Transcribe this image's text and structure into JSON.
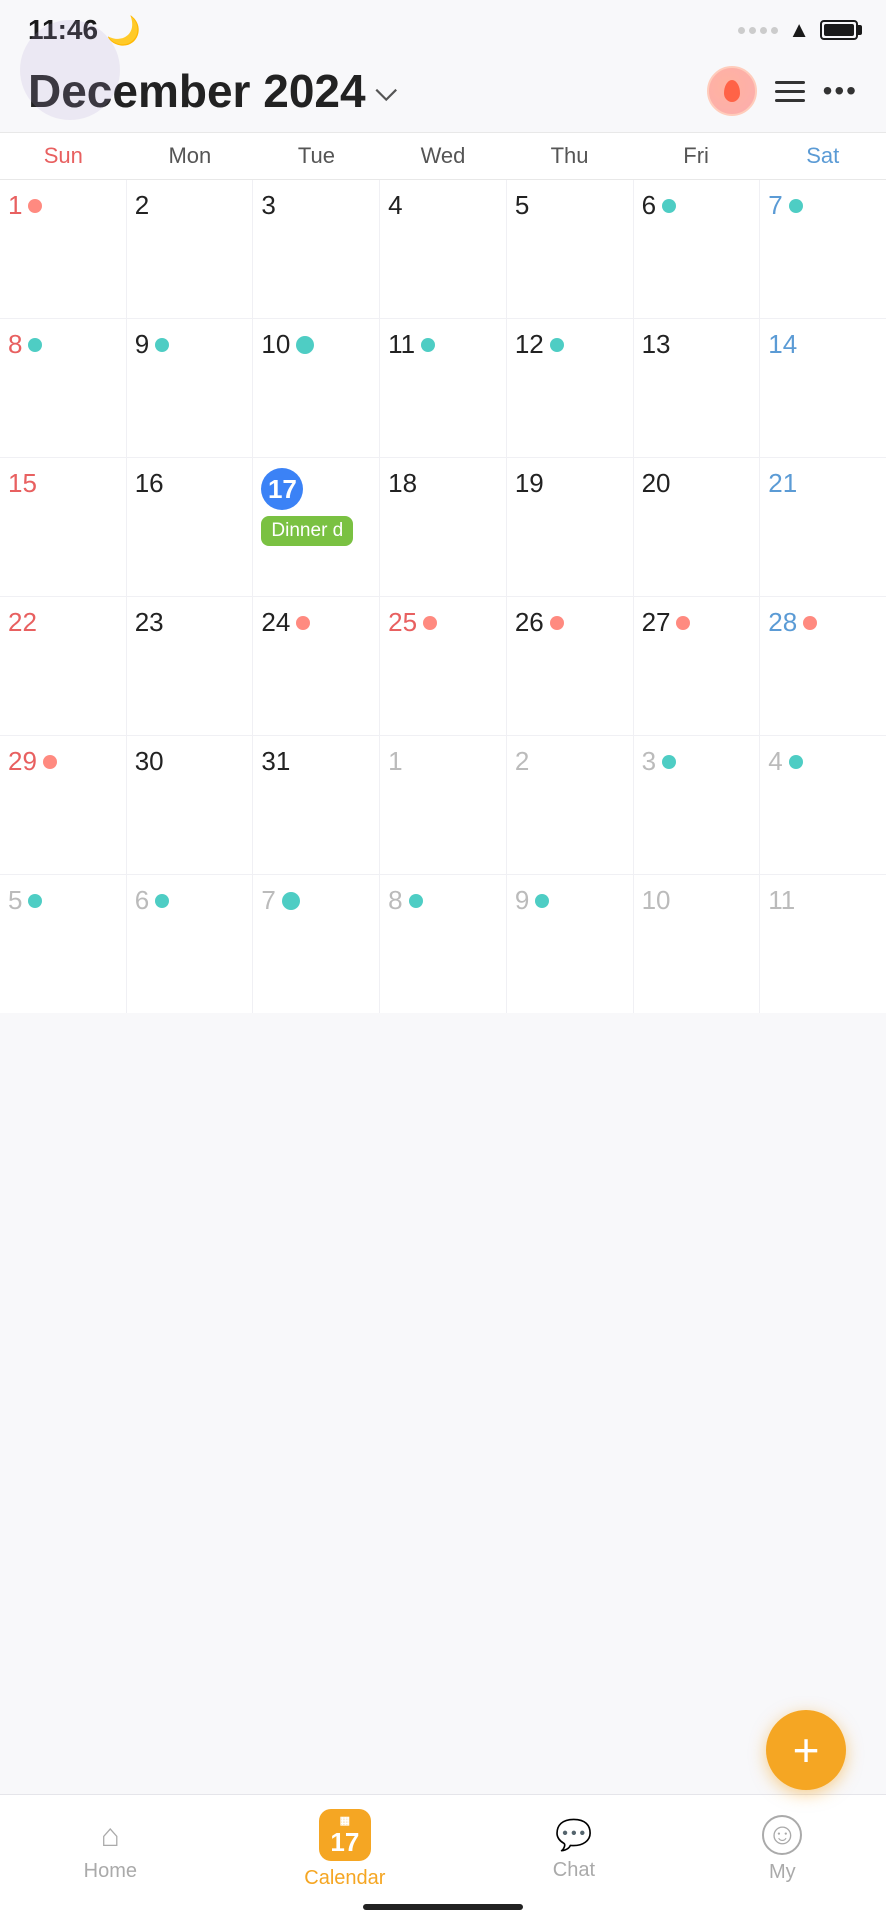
{
  "statusBar": {
    "time": "11:46",
    "moonIcon": "🌙"
  },
  "header": {
    "title": "December 2024",
    "chevron": "∨"
  },
  "daysOfWeek": [
    "Sun",
    "Mon",
    "Tue",
    "Wed",
    "Thu",
    "Fri",
    "Sat"
  ],
  "calendar": {
    "weeks": [
      [
        {
          "day": 1,
          "type": "sun",
          "dot": "red",
          "otherMonth": false
        },
        {
          "day": 2,
          "type": "",
          "dot": "",
          "otherMonth": false
        },
        {
          "day": 3,
          "type": "",
          "dot": "",
          "otherMonth": false
        },
        {
          "day": 4,
          "type": "",
          "dot": "",
          "otherMonth": false
        },
        {
          "day": 5,
          "type": "",
          "dot": "",
          "otherMonth": false
        },
        {
          "day": 6,
          "type": "",
          "dot": "teal",
          "otherMonth": false
        },
        {
          "day": 7,
          "type": "sat",
          "dot": "teal",
          "otherMonth": false
        }
      ],
      [
        {
          "day": 8,
          "type": "sun",
          "dot": "teal",
          "otherMonth": false
        },
        {
          "day": 9,
          "type": "",
          "dot": "teal",
          "otherMonth": false
        },
        {
          "day": 10,
          "type": "",
          "dot": "teal-lg",
          "otherMonth": false
        },
        {
          "day": 11,
          "type": "",
          "dot": "teal",
          "otherMonth": false
        },
        {
          "day": 12,
          "type": "",
          "dot": "teal",
          "otherMonth": false
        },
        {
          "day": 13,
          "type": "",
          "dot": "",
          "otherMonth": false
        },
        {
          "day": 14,
          "type": "sat",
          "dot": "",
          "otherMonth": false
        }
      ],
      [
        {
          "day": 15,
          "type": "sun",
          "dot": "",
          "otherMonth": false
        },
        {
          "day": 16,
          "type": "",
          "dot": "",
          "otherMonth": false
        },
        {
          "day": 17,
          "type": "today",
          "dot": "",
          "otherMonth": false,
          "event": "Dinner d"
        },
        {
          "day": 18,
          "type": "",
          "dot": "",
          "otherMonth": false
        },
        {
          "day": 19,
          "type": "",
          "dot": "",
          "otherMonth": false
        },
        {
          "day": 20,
          "type": "",
          "dot": "",
          "otherMonth": false
        },
        {
          "day": 21,
          "type": "sat",
          "dot": "",
          "otherMonth": false
        }
      ],
      [
        {
          "day": 22,
          "type": "sun",
          "dot": "",
          "otherMonth": false
        },
        {
          "day": 23,
          "type": "",
          "dot": "",
          "otherMonth": false
        },
        {
          "day": 24,
          "type": "",
          "dot": "red",
          "otherMonth": false
        },
        {
          "day": 25,
          "type": "sun",
          "dot": "red",
          "otherMonth": false
        },
        {
          "day": 26,
          "type": "",
          "dot": "red",
          "otherMonth": false
        },
        {
          "day": 27,
          "type": "",
          "dot": "red",
          "otherMonth": false
        },
        {
          "day": 28,
          "type": "sat",
          "dot": "red",
          "otherMonth": false
        }
      ],
      [
        {
          "day": 29,
          "type": "sun",
          "dot": "red",
          "otherMonth": false
        },
        {
          "day": 30,
          "type": "",
          "dot": "",
          "otherMonth": false
        },
        {
          "day": 31,
          "type": "",
          "dot": "",
          "otherMonth": false
        },
        {
          "day": 1,
          "type": "",
          "dot": "",
          "otherMonth": true
        },
        {
          "day": 2,
          "type": "",
          "dot": "",
          "otherMonth": true
        },
        {
          "day": 3,
          "type": "",
          "dot": "teal",
          "otherMonth": true
        },
        {
          "day": 4,
          "type": "sat",
          "dot": "teal",
          "otherMonth": true
        }
      ],
      [
        {
          "day": 5,
          "type": "sun",
          "dot": "teal",
          "otherMonth": true
        },
        {
          "day": 6,
          "type": "",
          "dot": "teal",
          "otherMonth": true
        },
        {
          "day": 7,
          "type": "",
          "dot": "teal-lg",
          "otherMonth": true
        },
        {
          "day": 8,
          "type": "",
          "dot": "teal",
          "otherMonth": true
        },
        {
          "day": 9,
          "type": "",
          "dot": "teal",
          "otherMonth": true
        },
        {
          "day": 10,
          "type": "",
          "dot": "",
          "otherMonth": true
        },
        {
          "day": 11,
          "type": "sat",
          "dot": "",
          "otherMonth": true
        }
      ]
    ]
  },
  "fab": {
    "label": "+"
  },
  "bottomNav": {
    "items": [
      {
        "id": "home",
        "label": "Home",
        "icon": "🏠",
        "active": false
      },
      {
        "id": "calendar",
        "label": "Calendar",
        "icon": "cal",
        "active": true,
        "badgeNum": "17"
      },
      {
        "id": "chat",
        "label": "Chat",
        "icon": "💬",
        "active": false
      },
      {
        "id": "my",
        "label": "My",
        "icon": "☺",
        "active": false
      }
    ]
  }
}
